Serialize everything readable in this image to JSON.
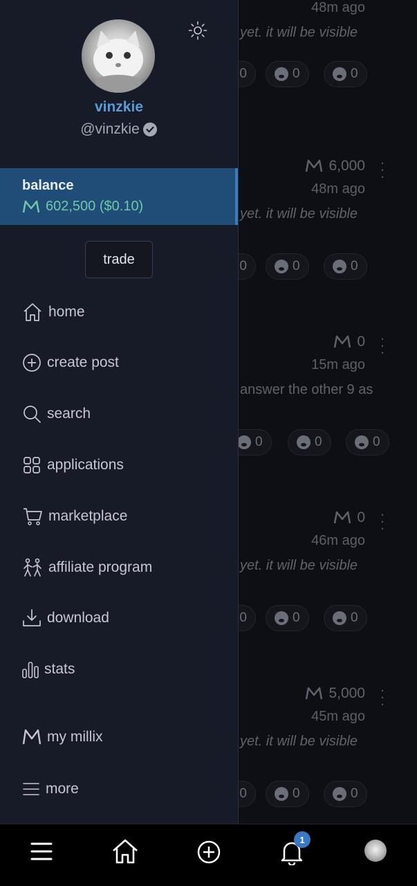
{
  "feed": {
    "posts": [
      {
        "amount": "",
        "time": "48m ago",
        "preview": "yet. it will be visible",
        "italic": true,
        "reactions": [
          "0",
          "0",
          "0"
        ]
      },
      {
        "amount": "6,000",
        "time": "48m ago",
        "preview": "yet. it will be visible",
        "italic": true,
        "reactions": [
          "0",
          "0",
          "0"
        ]
      },
      {
        "amount": "0",
        "time": "15m ago",
        "preview": "answer the other 9 as",
        "italic": false,
        "reactions": [
          "0",
          "0",
          "0"
        ]
      },
      {
        "amount": "0",
        "time": "46m ago",
        "preview": "yet. it will be visible",
        "italic": true,
        "reactions": [
          "0",
          "0",
          "0"
        ]
      },
      {
        "amount": "5,000",
        "time": "45m ago",
        "preview": "yet. it will be visible",
        "italic": true,
        "reactions": [
          "0",
          "0",
          "0"
        ]
      }
    ]
  },
  "drawer": {
    "username": "vinzkie",
    "handle": "@vinzkie",
    "theme_icon": "sun-icon",
    "balance_label": "balance",
    "balance_value": "602,500 ($0.10)",
    "trade_label": "trade",
    "nav": [
      {
        "label": "home",
        "icon": "home-icon"
      },
      {
        "label": "create post",
        "icon": "plus-circle-icon"
      },
      {
        "label": "search",
        "icon": "search-icon"
      },
      {
        "label": "applications",
        "icon": "grid-icon"
      },
      {
        "label": "marketplace",
        "icon": "cart-icon"
      },
      {
        "label": "affiliate program",
        "icon": "people-icon"
      },
      {
        "label": "download",
        "icon": "download-icon"
      },
      {
        "label": "stats",
        "icon": "bar-chart-icon"
      },
      {
        "label": "my millix",
        "icon": "millix-icon"
      },
      {
        "label": "more",
        "icon": "menu-icon"
      }
    ]
  },
  "bottombar": {
    "notification_count": "1",
    "icons": [
      "menu-icon",
      "home-icon",
      "plus-circle-icon",
      "bell-icon",
      "avatar"
    ]
  },
  "colors": {
    "drawer_bg": "#171a27",
    "balance_bg": "#1f4d77",
    "accent_blue": "#5b9bd5",
    "millix_green": "#6fc7a8"
  }
}
